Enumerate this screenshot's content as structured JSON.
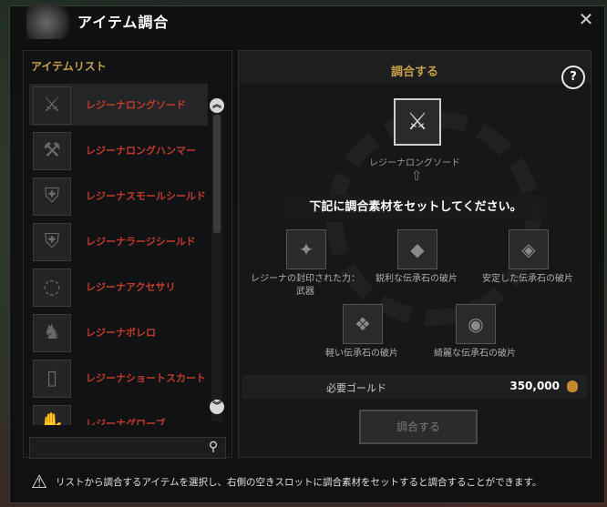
{
  "window": {
    "title": "アイテム調合",
    "close_icon": "close-icon"
  },
  "left": {
    "list_title": "アイテムリスト",
    "items": [
      {
        "label": "レジーナロングソード",
        "icon": "sword-icon",
        "selected": true
      },
      {
        "label": "レジーナロングハンマー",
        "icon": "hammer-icon",
        "selected": false
      },
      {
        "label": "レジーナスモールシールド",
        "icon": "small-shield-icon",
        "selected": false
      },
      {
        "label": "レジーナラージシールド",
        "icon": "large-shield-icon",
        "selected": false
      },
      {
        "label": "レジーナアクセサリ",
        "icon": "accessory-icon",
        "selected": false
      },
      {
        "label": "レジーナボレロ",
        "icon": "bolero-icon",
        "selected": false
      },
      {
        "label": "レジーナショートスカート",
        "icon": "skirt-icon",
        "selected": false
      },
      {
        "label": "レジーナグローブ",
        "icon": "glove-icon",
        "selected": false
      }
    ],
    "search_placeholder": ""
  },
  "right": {
    "title": "調合する",
    "help": "?",
    "result_label": "レジーナロングソード",
    "banner": "下記に調合素材をセットしてください。",
    "materials": [
      {
        "label": "レジーナの封印された力：武器",
        "icon": "sealed-power-icon"
      },
      {
        "label": "鋭利な伝承石の破片",
        "icon": "sharp-stone-icon"
      },
      {
        "label": "安定した伝承石の破片",
        "icon": "stable-stone-icon"
      },
      {
        "label": "軽い伝承石の破片",
        "icon": "light-stone-icon"
      },
      {
        "label": "綺麗な伝承石の破片",
        "icon": "pretty-stone-icon"
      }
    ],
    "gold_label": "必要ゴールド",
    "gold_value": "350,000",
    "button": "調合する"
  },
  "notice": "リストから調合するアイテムを選択し、右側の空きスロットに調合素材をセットすると調合することができます。",
  "colors": {
    "accent": "#c8a04c",
    "item_text": "#c23a2e"
  }
}
